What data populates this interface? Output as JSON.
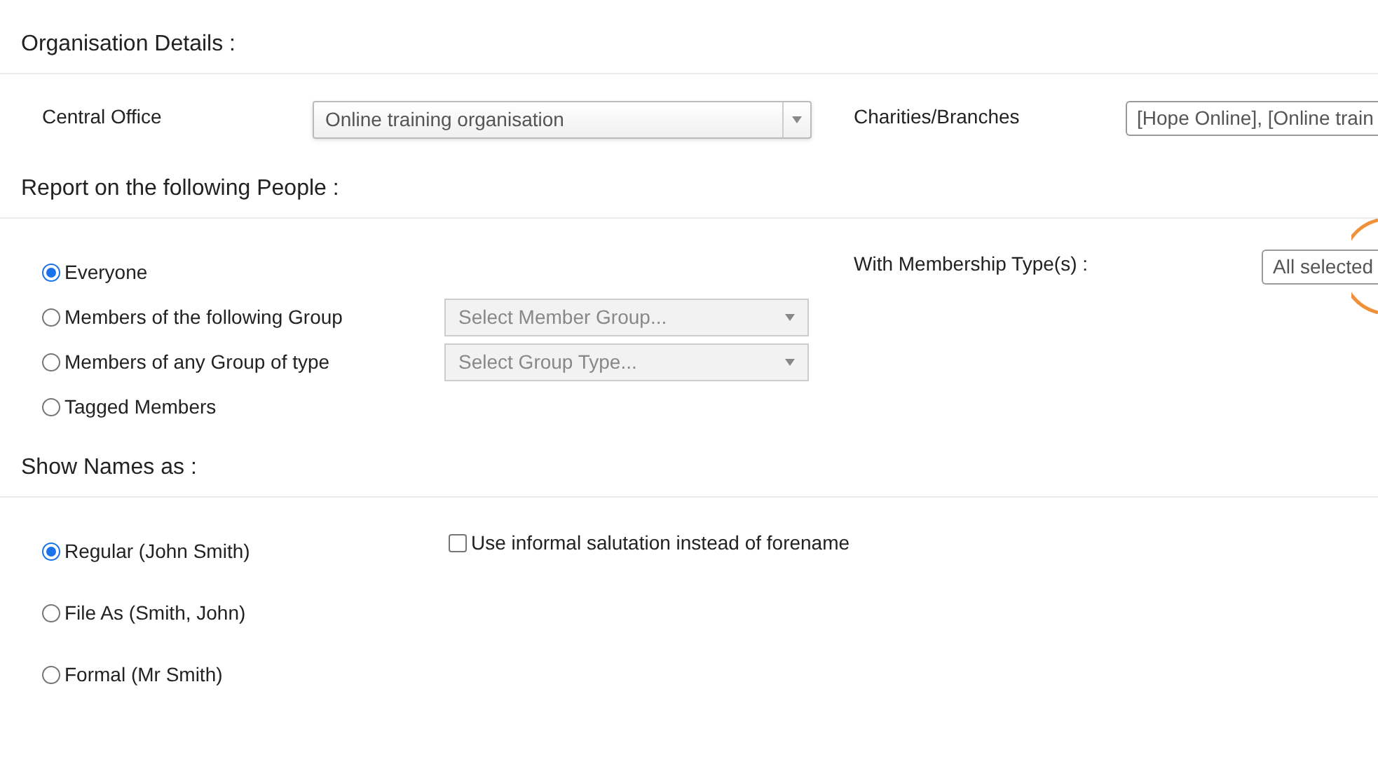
{
  "organisation": {
    "heading": "Organisation Details :",
    "central_office": {
      "label": "Central Office",
      "value": "Online training organisation"
    },
    "branches": {
      "label": "Charities/Branches",
      "value": "[Hope Online], [Online train"
    }
  },
  "people": {
    "heading": "Report on the following People :",
    "options": [
      {
        "label": "Everyone",
        "selected": true
      },
      {
        "label": "Members of the following Group",
        "selected": false,
        "placeholder": "Select Member Group..."
      },
      {
        "label": "Members of any Group of type",
        "selected": false,
        "placeholder": "Select Group Type..."
      },
      {
        "label": "Tagged Members",
        "selected": false
      }
    ],
    "membership": {
      "label": "With Membership Type(s) :",
      "value": "All selected"
    }
  },
  "names": {
    "heading": "Show Names as :",
    "options": [
      {
        "label": "Regular (John Smith)",
        "selected": true
      },
      {
        "label": "File As (Smith, John)",
        "selected": false
      },
      {
        "label": "Formal (Mr Smith)",
        "selected": false
      }
    ],
    "informal": {
      "label": "Use informal salutation instead of forename",
      "checked": false
    }
  }
}
